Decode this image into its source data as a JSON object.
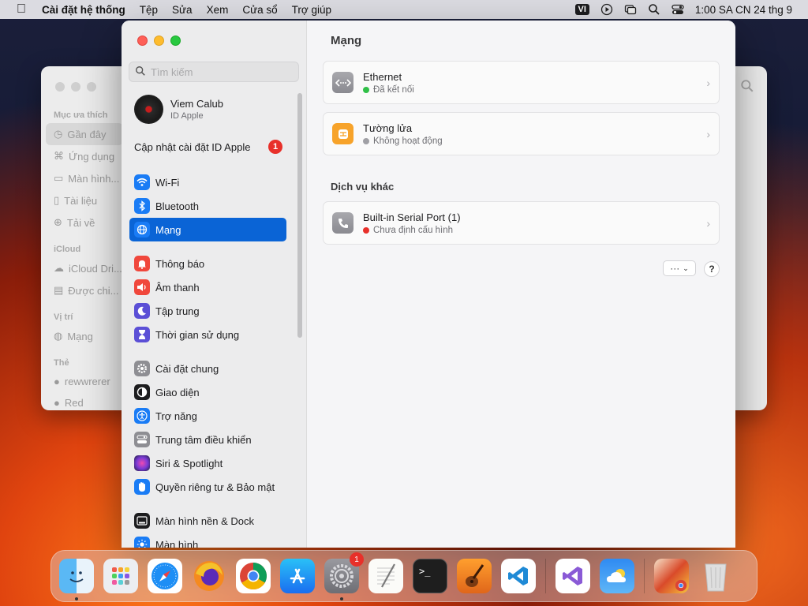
{
  "menubar": {
    "app_name": "Cài đặt hệ thống",
    "menus": [
      "Tệp",
      "Sửa",
      "Xem",
      "Cửa sổ",
      "Trợ giúp"
    ],
    "input_source": "VI",
    "clock": "1:00 SA CN 24 thg 9"
  },
  "finder": {
    "favorites_header": "Mục ưa thích",
    "items": [
      "Gần đây",
      "Ứng dụng",
      "Màn hình...",
      "Tài liệu",
      "Tải về"
    ],
    "icloud_header": "iCloud",
    "icloud_items": [
      "iCloud Dri...",
      "Được chi..."
    ],
    "location_header": "Vị trí",
    "location_items": [
      "Mạng"
    ],
    "tags_header": "Thẻ",
    "tags_items": [
      "rewwrerer",
      "Red"
    ]
  },
  "sidebar": {
    "search_placeholder": "Tìm kiếm",
    "account_name": "Viem Calub",
    "account_sub": "ID Apple",
    "update_label": "Cập nhật cài đặt ID Apple",
    "update_count": "1",
    "items": [
      {
        "label": "Wi-Fi",
        "icon": "wifi-icon",
        "color": "#1a7cf5"
      },
      {
        "label": "Bluetooth",
        "icon": "bluetooth-icon",
        "color": "#1a7cf5"
      },
      {
        "label": "Mạng",
        "icon": "globe-icon",
        "color": "#1a7cf5"
      },
      {
        "label": "Thông báo",
        "icon": "bell-icon",
        "color": "#f0473c"
      },
      {
        "label": "Âm thanh",
        "icon": "speaker-icon",
        "color": "#f0473c"
      },
      {
        "label": "Tập trung",
        "icon": "moon-icon",
        "color": "#5b4fd6"
      },
      {
        "label": "Thời gian sử dụng",
        "icon": "hourglass-icon",
        "color": "#5b4fd6"
      },
      {
        "label": "Cài đặt chung",
        "icon": "gear-icon",
        "color": "#8e8e93"
      },
      {
        "label": "Giao diện",
        "icon": "appearance-icon",
        "color": "#1d1d1f"
      },
      {
        "label": "Trợ năng",
        "icon": "accessibility-icon",
        "color": "#1a7cf5"
      },
      {
        "label": "Trung tâm điều khiển",
        "icon": "control-center-icon",
        "color": "#8e8e93"
      },
      {
        "label": "Siri & Spotlight",
        "icon": "siri-icon",
        "color": "#b23ad6"
      },
      {
        "label": "Quyền riêng tư & Bảo mật",
        "icon": "hand-icon",
        "color": "#1a7cf5"
      },
      {
        "label": "Màn hình nền & Dock",
        "icon": "dock-icon",
        "color": "#1d1d1f"
      },
      {
        "label": "Màn hình",
        "icon": "display-icon",
        "color": "#1a7cf5"
      }
    ],
    "active_index": 2
  },
  "main": {
    "title": "Mạng",
    "services": [
      {
        "name": "Ethernet",
        "status": "Đã kết nối",
        "status_color": "#30c048",
        "icon": "ethernet-icon"
      },
      {
        "name": "Tường lửa",
        "status": "Không hoạt động",
        "status_color": "#a0a0a5",
        "icon": "firewall-icon"
      }
    ],
    "other_services_header": "Dịch vụ khác",
    "other_services": [
      {
        "name": "Built-in Serial Port (1)",
        "status": "Chưa định cấu hình",
        "status_color": "#e8302a",
        "icon": "serial-port-icon"
      }
    ],
    "more_button": "···",
    "help_button": "?"
  },
  "dock": {
    "apps": [
      "finder",
      "launchpad",
      "safari",
      "firefox",
      "chrome",
      "app-store",
      "system-settings",
      "textedit",
      "terminal",
      "garageband",
      "vscode",
      "visual-studio",
      "weather",
      "preview",
      "trash"
    ],
    "system_settings_badge": "1"
  }
}
